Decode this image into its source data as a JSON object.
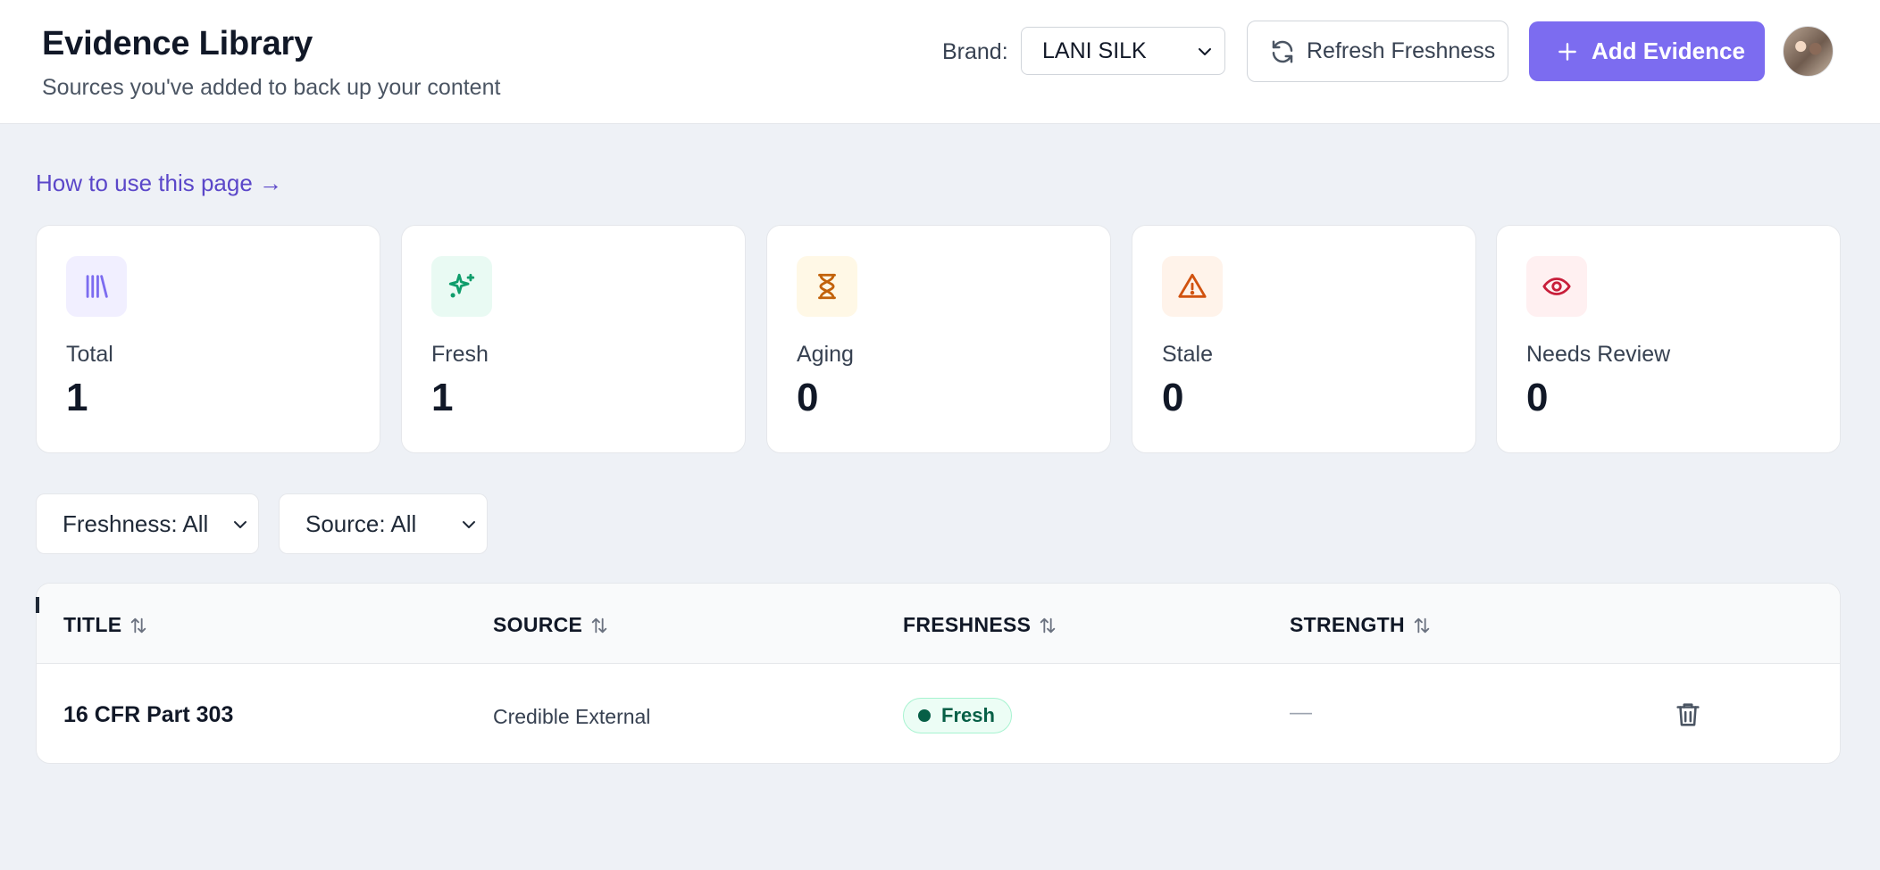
{
  "header": {
    "title": "Evidence Library",
    "subtitle": "Sources you've added to back up your content",
    "brand_label": "Brand:",
    "brand_value": "LANI SILK",
    "refresh_label": "Refresh Freshness",
    "add_label": "Add Evidence"
  },
  "help_link": "How to use this page →",
  "stats": [
    {
      "label": "Total",
      "value": "1",
      "icon": "library-icon",
      "color": "#7c6cf0",
      "bg": "#f1efff"
    },
    {
      "label": "Fresh",
      "value": "1",
      "icon": "sparkles-icon",
      "color": "#0f9d6b",
      "bg": "#e9faf3"
    },
    {
      "label": "Aging",
      "value": "0",
      "icon": "hourglass-icon",
      "color": "#c2620a",
      "bg": "#fff8e6"
    },
    {
      "label": "Stale",
      "value": "0",
      "icon": "warning-icon",
      "color": "#d1520f",
      "bg": "#fff3ea"
    },
    {
      "label": "Needs Review",
      "value": "0",
      "icon": "eye-icon",
      "color": "#c81e3a",
      "bg": "#fff0f1"
    }
  ],
  "filters": {
    "freshness": "Freshness: All",
    "source": "Source: All"
  },
  "table": {
    "columns": [
      "TITLE",
      "SOURCE",
      "FRESHNESS",
      "STRENGTH"
    ],
    "rows": [
      {
        "title": "16 CFR Part 303",
        "source": "Credible External",
        "freshness": "Fresh",
        "strength": "—"
      }
    ]
  }
}
